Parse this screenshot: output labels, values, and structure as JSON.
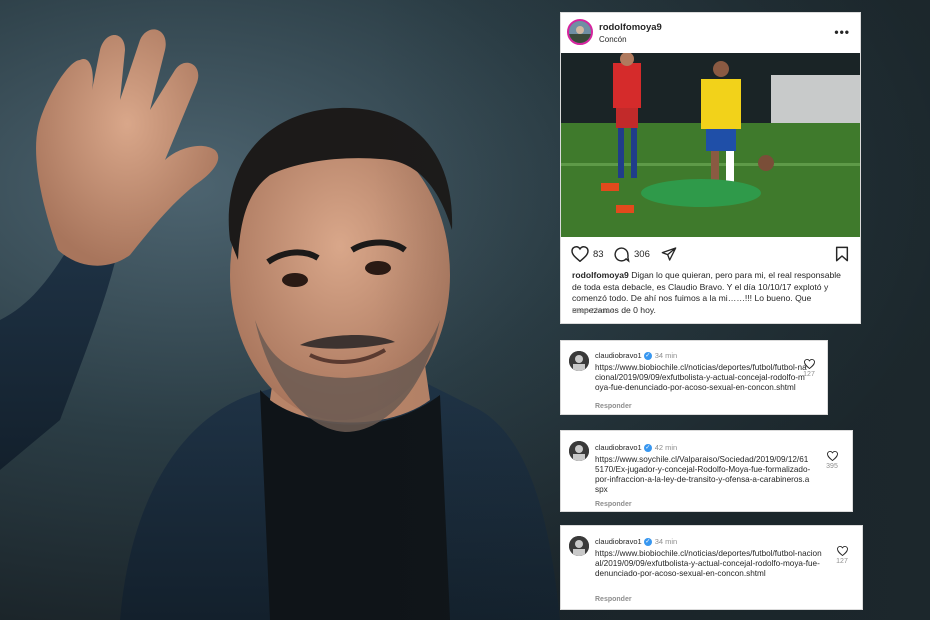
{
  "post": {
    "username": "rodolfomoya9",
    "location": "Concón",
    "more_label": "•••",
    "likes": "83",
    "comments": "306",
    "caption_user": "rodolfomoya9",
    "caption_text": "Digan lo que quieran, pero para mi, el real responsable de toda esta debacle, es Claudio Bravo. Y el día 10/10/17 explotó y comenzó todo. De ahí nos fuimos a la mi……!!! Lo bueno. Que empezamos de 0 hoy.",
    "time_ago": "Hace 2 horas"
  },
  "comments": [
    {
      "username": "claudiobravo1",
      "verified": "✓",
      "ago": "34 min",
      "text": "https://www.biobiochile.cl/noticias/deportes/futbol/futbol-nacional/2019/09/09/exfutbolista-y-actual-concejal-rodolfo-moya-fue-denunciado-por-acoso-sexual-en-concon.shtml",
      "reply": "Responder",
      "likes": "127"
    },
    {
      "username": "claudiobravo1",
      "verified": "✓",
      "ago": "42 min",
      "text": "https://www.soychile.cl/Valparaiso/Sociedad/2019/09/12/615170/Ex-jugador-y-concejal-Rodolfo-Moya-fue-formalizado-por-infraccion-a-la-ley-de-transito-y-ofensa-a-carabineros.aspx",
      "reply": "Responder",
      "likes": "395"
    },
    {
      "username": "claudiobravo1",
      "verified": "✓",
      "ago": "34 min",
      "text": "https://www.biobiochile.cl/noticias/deportes/futbol/futbol-nacional/2019/09/09/exfutbolista-y-actual-concejal-rodolfo-moya-fue-denunciado-por-acoso-sexual-en-concon.shtml",
      "reply": "Responder",
      "likes": "127"
    }
  ],
  "colors": {
    "verified": "#3897f0",
    "text": "#262626",
    "muted": "#8e8e8e"
  }
}
